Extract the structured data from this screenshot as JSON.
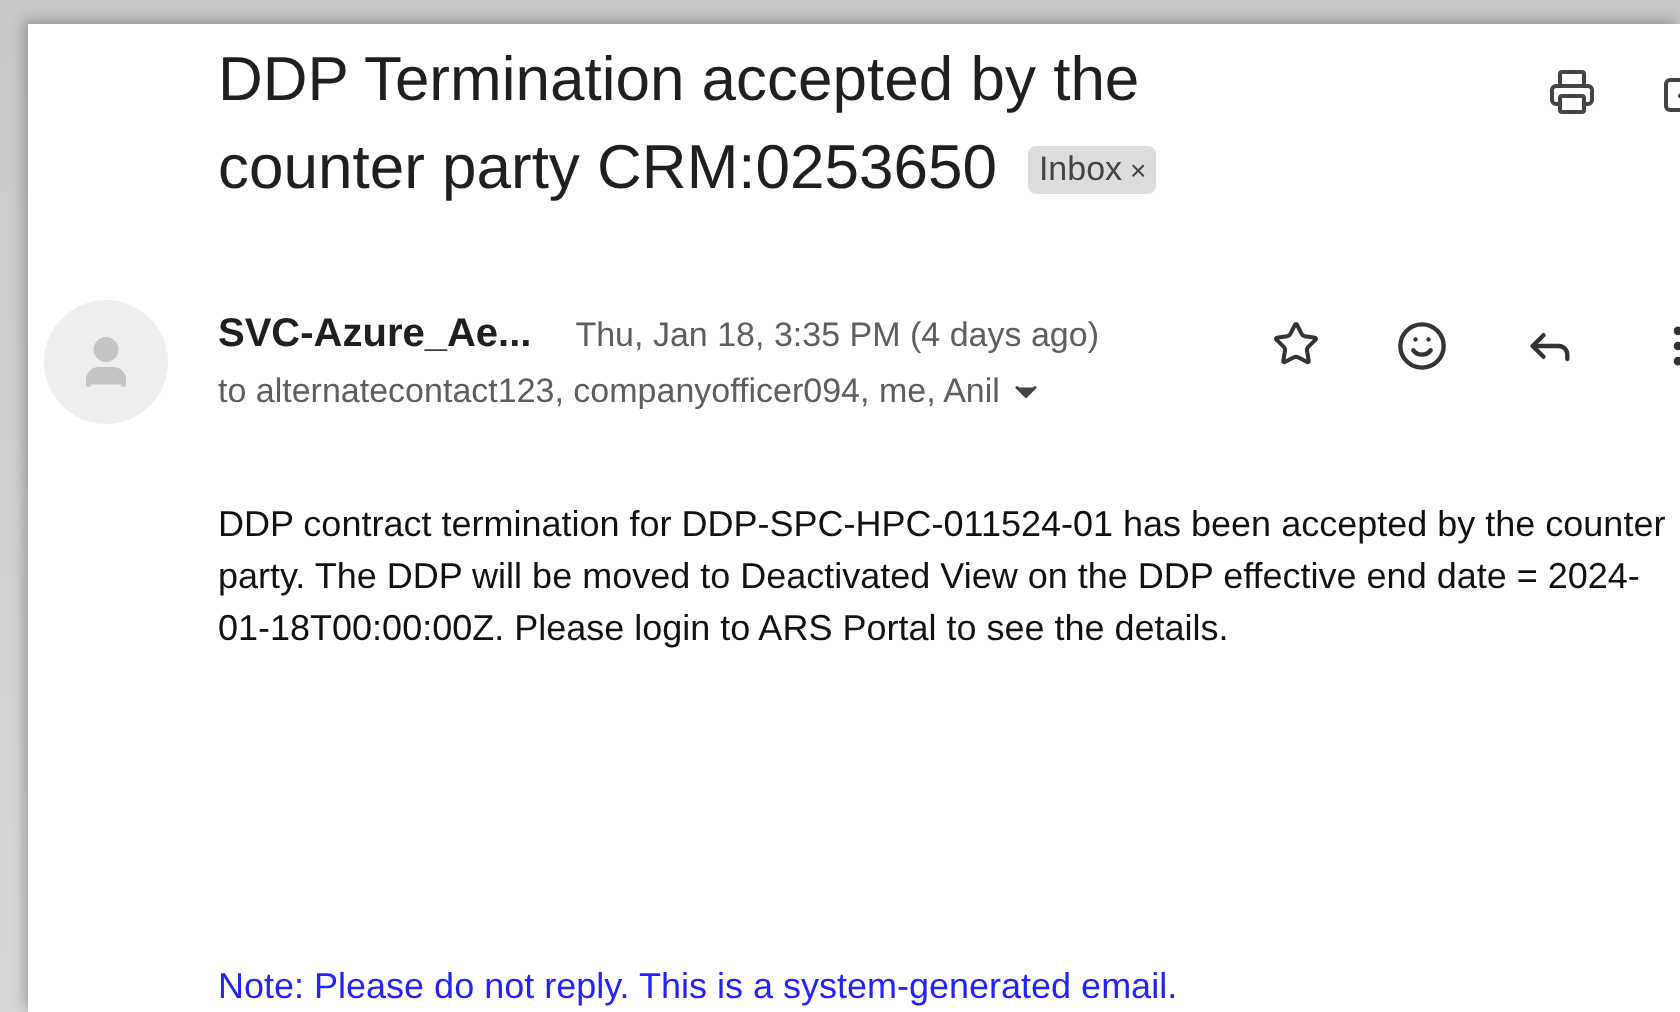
{
  "subject_lines": [
    "DDP Termination accepted by the",
    "counter party CRM:0253650"
  ],
  "label_chip": {
    "text": "Inbox",
    "remove": "×"
  },
  "sender": {
    "name": "SVC-Azure_Ae...",
    "date": "Thu, Jan 18, 3:35 PM (4 days ago)",
    "recipients": "to alternatecontact123, companyofficer094, me, Anil",
    "starred": false
  },
  "body": [
    "DDP contract termination for DDP-SPC-HPC-011524-01 has been accepted by the counter party. The DDP will be moved to Deactivated View on the DDP effective end date = 2024-01-18T00:00:00Z. Please login to ARS Portal to see the details."
  ],
  "note": "Note: Please do not reply. This is a system-generated email."
}
